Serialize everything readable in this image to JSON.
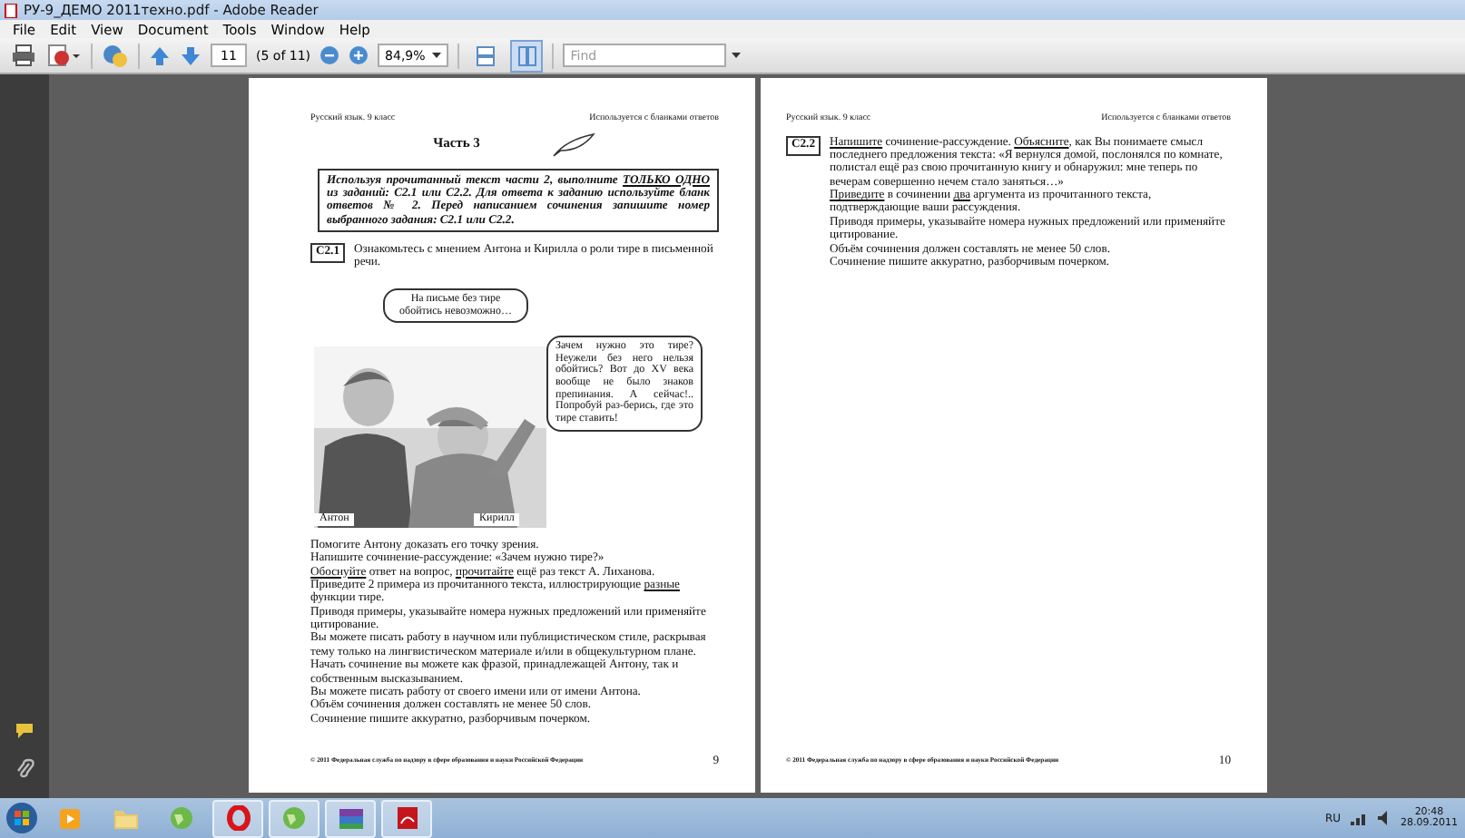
{
  "window": {
    "title": "РУ-9_ДЕМО 2011техно.pdf - Adobe Reader"
  },
  "menu": [
    "File",
    "Edit",
    "View",
    "Document",
    "Tools",
    "Window",
    "Help"
  ],
  "toolbar": {
    "page_number": "11",
    "page_count": "(5 of 11)",
    "zoom": "84,9%",
    "find_placeholder": "Find",
    "layout_buttons": [
      {
        "selected": false
      },
      {
        "selected": true
      }
    ]
  },
  "pages": [
    {
      "header_left": "Русский язык. 9 класс",
      "header_right": "Используется с бланками ответов",
      "part_title": "Часть 3",
      "instruction": [
        {
          "text": "Используя прочитанный текст части 2, выполните ",
          "underlined": false
        },
        {
          "text": "ТОЛЬКО ОДНО",
          "underlined": true
        },
        {
          "text": " из заданий: С2.1 или С2.2. Для ответа к заданию используйте бланк ответов № 2. Перед написанием сочинения запишите номер выбранного задания: С2.1 или С2.2.",
          "underlined": false
        }
      ],
      "task_code": "С2.1",
      "task_paragraphs": [
        [
          {
            "text": "Ознакомьтесь с мнением Антона и Кирилла о роли тире в письменной речи.",
            "underlined": false
          }
        ]
      ],
      "illustration": {
        "kind": "picture",
        "bubble_left": "На письме без тире обойтись невозможно…",
        "bubble_right": "Зачем нужно это тире? Неужели без него нельзя обойтись? Вот до XV века вообще не было знаков препинания. А сейчас!.. Попробуй раз-берись, где это тире ставить!",
        "caption_left": "Антон",
        "caption_right": "Кирилл"
      },
      "paragraphs": [
        [
          {
            "text": "Помогите Антону доказать его точку зрения.",
            "underlined": false
          }
        ],
        [
          {
            "text": "Напишите сочинение-рассуждение: «Зачем нужно тире?»",
            "underlined": false
          }
        ],
        [
          {
            "text": "Обоснуйте",
            "underlined": true
          },
          {
            "text": " ответ на вопрос, ",
            "underlined": false
          },
          {
            "text": "прочитайте",
            "underlined": true
          },
          {
            "text": " ещё раз текст А. Лиханова.",
            "underlined": false
          }
        ],
        [
          {
            "text": "Приведите 2 примера из прочитанного текста, иллюстрирующие ",
            "underlined": false
          },
          {
            "text": "разные",
            "underlined": true
          },
          {
            "text": " функции тире.",
            "underlined": false
          }
        ],
        [
          {
            "text": "Приводя примеры, указывайте номера нужных предложений или применяйте цитирование.",
            "underlined": false
          }
        ],
        [
          {
            "text": "Вы можете писать работу в научном или публицистическом стиле, раскрывая тему только на лингвистическом материале и/или в общекультурном плане.",
            "underlined": false
          }
        ],
        [
          {
            "text": "Начать сочинение вы можете как фразой, принадлежащей Антону, так и собственным высказыванием.",
            "underlined": false
          }
        ],
        [
          {
            "text": "Вы можете писать работу от своего имени или от имени Антона.",
            "underlined": false
          }
        ],
        [
          {
            "text": "Объём сочинения должен составлять не менее 50 слов.",
            "underlined": false
          }
        ],
        [
          {
            "text": "Сочинение пишите аккуратно, разборчивым почерком.",
            "underlined": false
          }
        ]
      ],
      "footer": "© 2011 Федеральная служба по надзору в сфере образования и науки Российской Федерации",
      "page_number": "9"
    },
    {
      "header_left": "Русский язык. 9 класс",
      "header_right": "Используется с бланками ответов",
      "task_code": "С2.2",
      "task_paragraphs": [
        [
          {
            "text": "Напишите",
            "underlined": true
          },
          {
            "text": " сочинение-рассуждение. ",
            "underlined": false
          },
          {
            "text": "Объясните",
            "underlined": true
          },
          {
            "text": ", как Вы понимаете смысл последнего предложения текста: «Я вернулся домой, послонялся по комнате, полистал ещё раз свою прочитанную книгу и обнаружил: мне теперь по вечерам совершенно нечем стало заняться…»",
            "underlined": false
          }
        ],
        [
          {
            "text": "Приведите",
            "underlined": true
          },
          {
            "text": " в сочинении ",
            "underlined": false
          },
          {
            "text": "два",
            "underlined": true
          },
          {
            "text": " аргумента из прочитанного текста, подтверждающие ваши рассуждения.",
            "underlined": false
          }
        ],
        [
          {
            "text": "Приводя примеры, указывайте номера нужных предложений или применяйте цитирование.",
            "underlined": false
          }
        ],
        [
          {
            "text": "Объём сочинения должен составлять не менее 50 слов.",
            "underlined": false
          }
        ],
        [
          {
            "text": "Сочинение пишите аккуратно, разборчивым почерком.",
            "underlined": false
          }
        ]
      ],
      "footer": "© 2011 Федеральная служба по надзору в сфере образования и науки Российской Федерации",
      "page_number": "10"
    }
  ],
  "taskbar": {
    "apps": [
      {
        "kind": "media",
        "active": false
      },
      {
        "kind": "folder",
        "active": false
      },
      {
        "kind": "globe",
        "active": false
      },
      {
        "kind": "opera",
        "active": true
      },
      {
        "kind": "globe",
        "active": true
      },
      {
        "kind": "archive",
        "active": true
      },
      {
        "kind": "pdf",
        "active": true
      }
    ],
    "language": "RU",
    "time": "20:48",
    "date": "28.09.2011"
  }
}
